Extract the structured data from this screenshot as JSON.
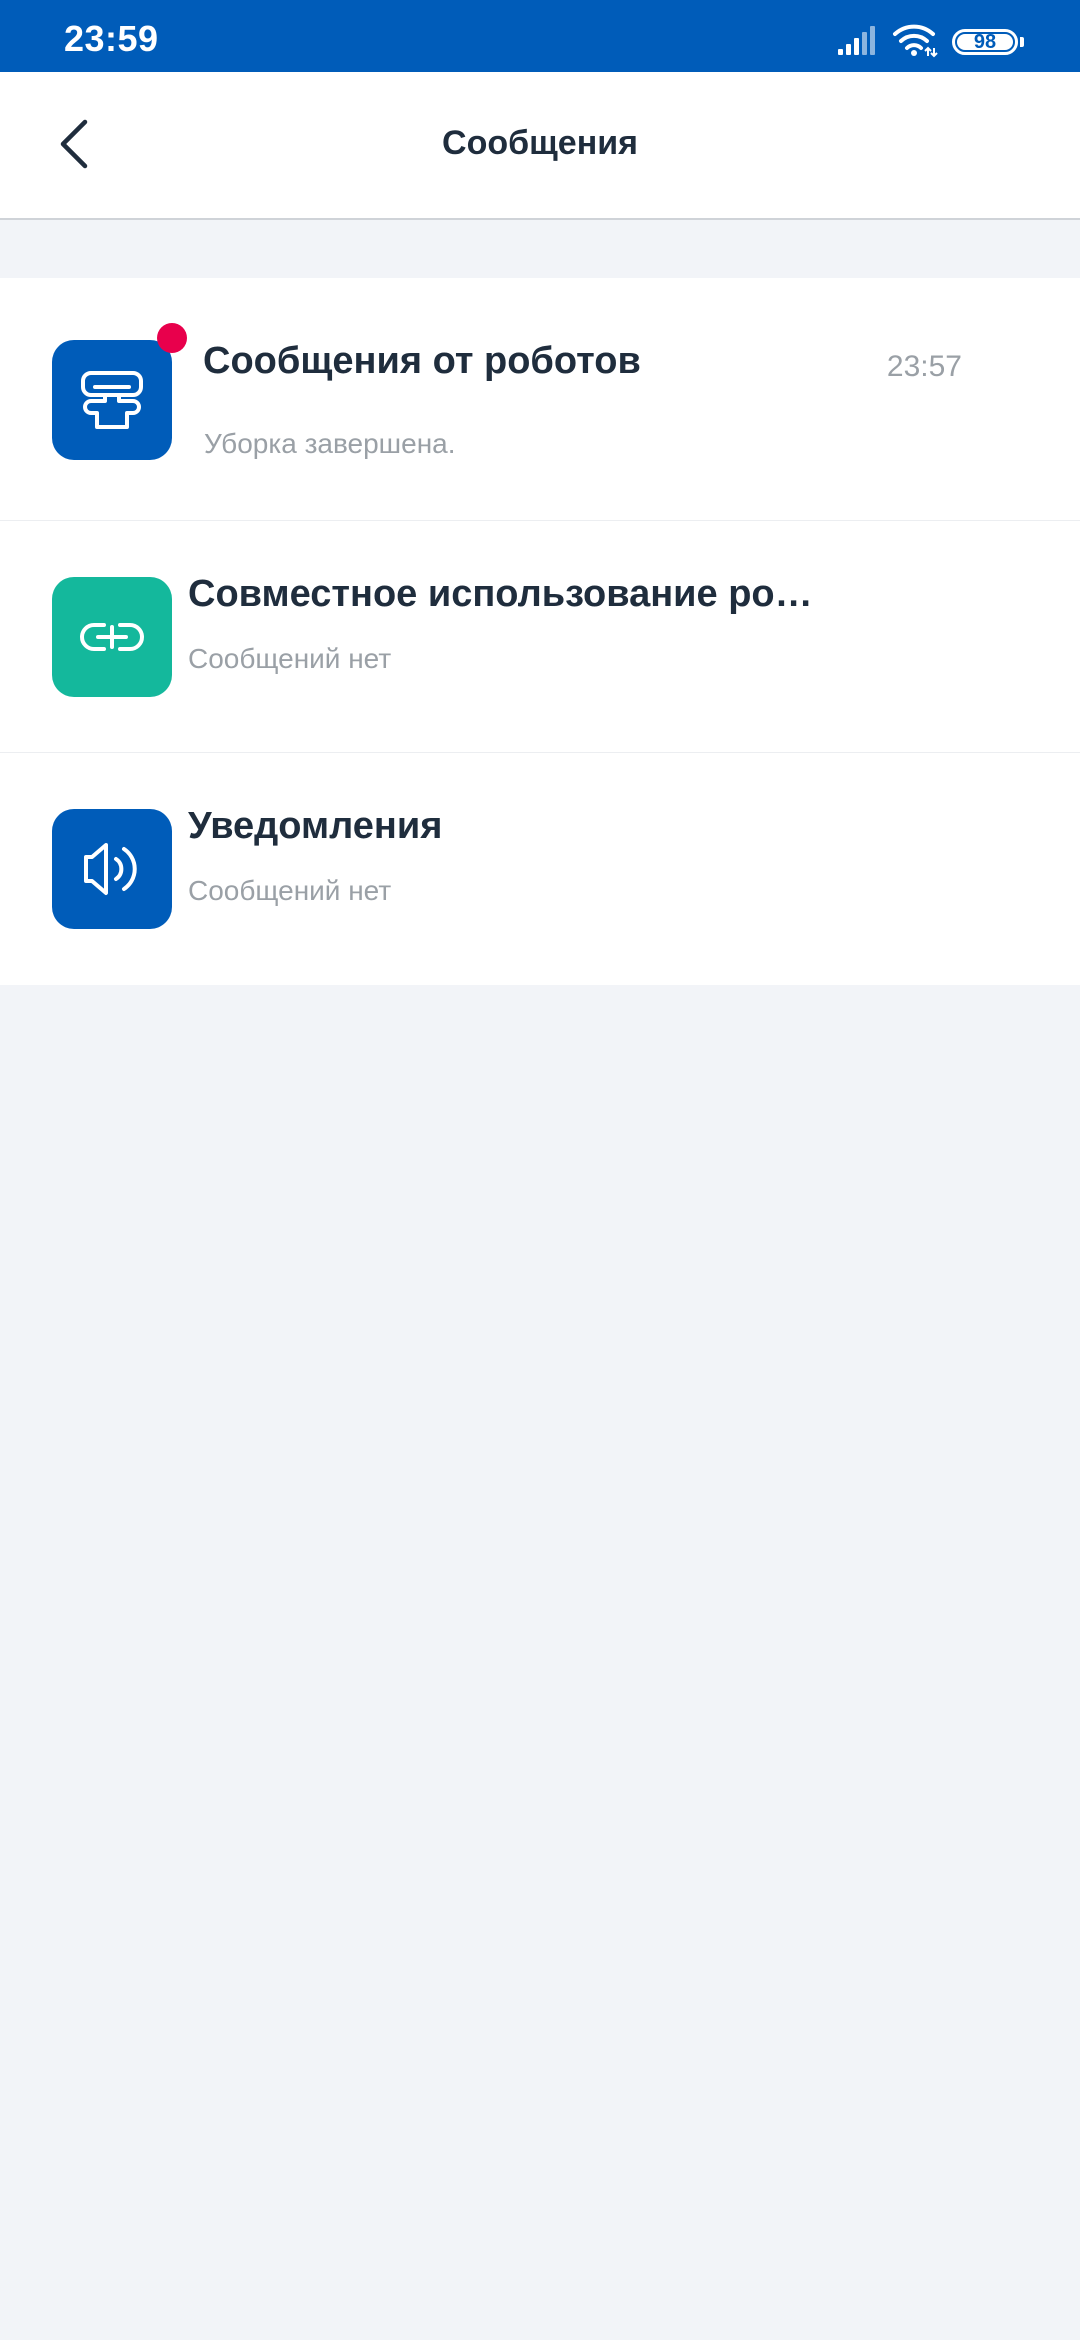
{
  "status_bar": {
    "time": "23:59",
    "battery": "98",
    "icons": [
      "signal-icon",
      "wifi-icon",
      "battery-icon"
    ]
  },
  "header": {
    "back_icon": "chevron-left-icon",
    "title": "Сообщения"
  },
  "messages": [
    {
      "icon": "robot-vacuum-icon",
      "icon_color": "#005cb9",
      "title": "Сообщения от роботов",
      "subtitle": "Уборка завершена.",
      "time": "23:57",
      "unread": true
    },
    {
      "icon": "link-icon",
      "icon_color": "#14b89c",
      "title": "Совместное использование ро…",
      "subtitle": "Сообщений нет"
    },
    {
      "icon": "speaker-icon",
      "icon_color": "#005cb9",
      "title": "Уведомления",
      "subtitle": "Сообщений нет"
    }
  ],
  "colors": {
    "status_bar": "#005cb9",
    "background": "#f2f4f8",
    "unread_dot": "#e8004c",
    "title_text": "#1f2d3d",
    "secondary_text": "#9aa0a6"
  }
}
